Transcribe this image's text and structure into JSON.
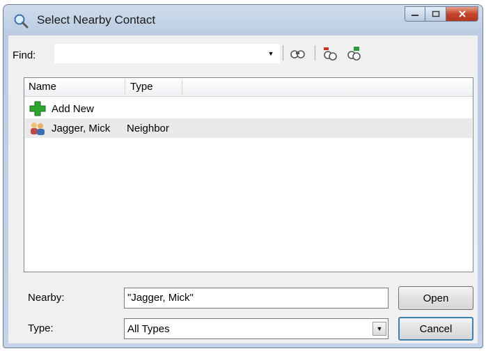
{
  "window": {
    "title": "Select Nearby Contact",
    "icon": "magnifier-icon",
    "caption_buttons": {
      "minimize": "minimize-icon",
      "maximize": "maximize-icon",
      "close": "close-icon"
    }
  },
  "toolbar": {
    "find_label": "Find:",
    "find_value": "",
    "buttons": [
      {
        "name": "find-next-icon"
      },
      {
        "name": "find-previous-icon"
      },
      {
        "name": "refresh-icon"
      }
    ]
  },
  "list": {
    "columns": [
      "Name",
      "Type"
    ],
    "rows": [
      {
        "icon": "add-plus-icon",
        "name": "Add New",
        "type": ""
      },
      {
        "icon": "contacts-icon",
        "name": "Jagger, Mick",
        "type": "Neighbor",
        "selected": true
      }
    ]
  },
  "form": {
    "nearby_label": "Nearby:",
    "nearby_value": "\"Jagger, Mick\"",
    "type_label": "Type:",
    "type_value": "All Types"
  },
  "buttons": {
    "open": "Open",
    "cancel": "Cancel"
  },
  "colors": {
    "titlebar": "#c3d3e8",
    "close_button": "#c4452a",
    "default_button_border": "#3c7fb1"
  }
}
